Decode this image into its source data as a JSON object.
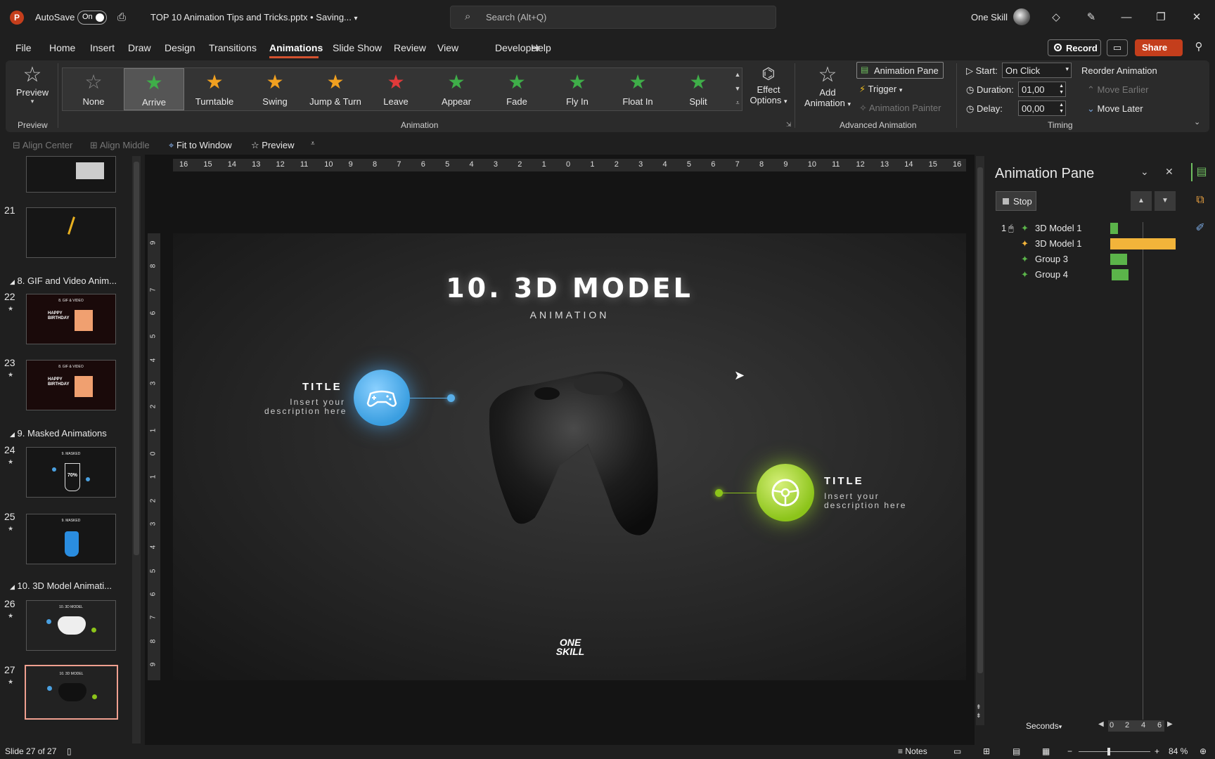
{
  "titlebar": {
    "app_letter": "P",
    "autosave_label": "AutoSave",
    "autosave_state": "On",
    "doc_title": "TOP 10 Animation Tips and Tricks.pptx • Saving...",
    "search_placeholder": "Search (Alt+Q)",
    "user_name": "One Skill"
  },
  "menu": {
    "tabs": [
      "File",
      "Home",
      "Insert",
      "Draw",
      "Design",
      "Transitions",
      "Animations",
      "Slide Show",
      "Review",
      "View",
      "Developer",
      "Help"
    ],
    "active": "Animations",
    "record_label": "Record",
    "share_label": "Share"
  },
  "ribbon": {
    "preview_label": "Preview",
    "preview_group": "Preview",
    "animations": [
      {
        "label": "None",
        "color": "#888888"
      },
      {
        "label": "Arrive",
        "color": "#3fae49"
      },
      {
        "label": "Turntable",
        "color": "#f0a020"
      },
      {
        "label": "Swing",
        "color": "#f0a020"
      },
      {
        "label": "Jump & Turn",
        "color": "#f0a020"
      },
      {
        "label": "Leave",
        "color": "#e03a3a"
      },
      {
        "label": "Appear",
        "color": "#3fae49"
      },
      {
        "label": "Fade",
        "color": "#3fae49"
      },
      {
        "label": "Fly In",
        "color": "#3fae49"
      },
      {
        "label": "Float In",
        "color": "#3fae49"
      },
      {
        "label": "Split",
        "color": "#3fae49"
      }
    ],
    "selected_animation": "Arrive",
    "effect_options": [
      "Effect",
      "Options"
    ],
    "animation_group": "Animation",
    "add_animation": [
      "Add",
      "Animation"
    ],
    "animation_pane": "Animation Pane",
    "trigger": "Trigger",
    "animation_painter": "Animation Painter",
    "advanced_group": "Advanced Animation",
    "start_label": "Start:",
    "start_value": "On Click",
    "duration_label": "Duration:",
    "duration_value": "01,00",
    "delay_label": "Delay:",
    "delay_value": "00,00",
    "timing_group": "Timing",
    "reorder_label": "Reorder Animation",
    "move_earlier": "Move Earlier",
    "move_later": "Move Later"
  },
  "quickaccess": {
    "align_center": "Align Center",
    "align_middle": "Align Middle",
    "fit_window": "Fit to Window",
    "preview": "Preview"
  },
  "ruler": {
    "h_ticks": [
      "16",
      "15",
      "14",
      "13",
      "12",
      "11",
      "10",
      "9",
      "8",
      "7",
      "6",
      "5",
      "4",
      "3",
      "2",
      "1",
      "0",
      "1",
      "2",
      "3",
      "4",
      "5",
      "6",
      "7",
      "8",
      "9",
      "10",
      "11",
      "12",
      "13",
      "14",
      "15",
      "16"
    ],
    "v_ticks": [
      "9",
      "8",
      "7",
      "6",
      "5",
      "4",
      "3",
      "2",
      "1",
      "0",
      "1",
      "2",
      "3",
      "4",
      "5",
      "6",
      "7",
      "8",
      "9"
    ]
  },
  "thumbnails": {
    "slides": [
      {
        "num": "21",
        "star": ""
      },
      {
        "num": "22",
        "star": "★"
      },
      {
        "num": "23",
        "star": "★"
      },
      {
        "num": "24",
        "star": "★"
      },
      {
        "num": "25",
        "star": "★"
      },
      {
        "num": "26",
        "star": "★"
      },
      {
        "num": "27",
        "star": "★"
      }
    ],
    "sections": [
      "8. GIF and Video Anim...",
      "9. Masked Animations",
      "10. 3D Model Animati..."
    ],
    "thumb_texts": {
      "gif_video": "8. GIF & VIDEO",
      "happy_birthday": "HAPPY BIRTHDAY",
      "masked": "9. MASKED",
      "percent": "70%",
      "model3d": "10. 3D MODEL"
    }
  },
  "slide": {
    "title": "10. 3D MODEL",
    "subtitle": "ANIMATION",
    "callout_left_title": "TITLE",
    "callout_left_desc1": "Insert your",
    "callout_left_desc2": "description here",
    "callout_right_title": "TITLE",
    "callout_right_desc1": "Insert your",
    "callout_right_desc2": "description here",
    "logo_line1": "ONE",
    "logo_line2": "SKILL"
  },
  "animation_pane": {
    "title": "Animation Pane",
    "stop_label": "Stop",
    "items": [
      {
        "num": "1",
        "label": "3D Model 1",
        "bar_color": "#5bb44a",
        "bar_start": 0.0,
        "bar_length": 0.12
      },
      {
        "num": "",
        "label": "3D Model 1",
        "bar_color": "#f2b43a",
        "bar_start": 0.0,
        "bar_length": 1.0
      },
      {
        "num": "",
        "label": "Group 3",
        "bar_color": "#5bb44a",
        "bar_start": 0.0,
        "bar_length": 0.26
      },
      {
        "num": "",
        "label": "Group 4",
        "bar_color": "#5bb44a",
        "bar_start": 0.02,
        "bar_length": 0.26
      }
    ],
    "seconds_label": "Seconds",
    "scale": [
      "0",
      "2",
      "4",
      "6"
    ]
  },
  "statusbar": {
    "slide_info": "Slide 27 of 27",
    "notes": "Notes",
    "zoom": "84 %",
    "zoom_level": 0.42
  }
}
